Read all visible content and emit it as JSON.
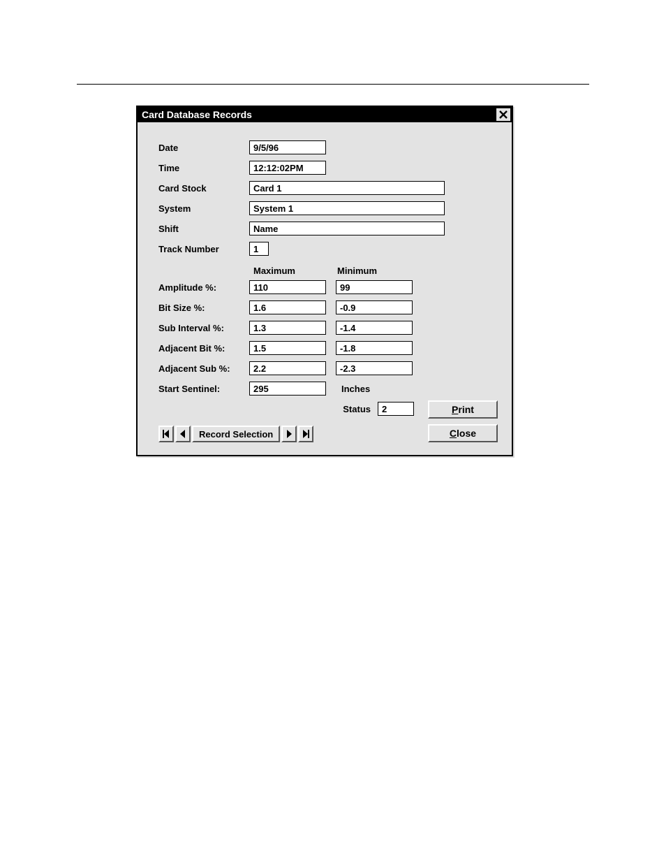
{
  "window": {
    "title": "Card Database Records"
  },
  "fields": {
    "date": {
      "label": "Date",
      "value": "9/5/96"
    },
    "time": {
      "label": "Time",
      "value": "12:12:02PM"
    },
    "card_stock": {
      "label": "Card Stock",
      "value": "Card 1"
    },
    "system": {
      "label": "System",
      "value": "System 1"
    },
    "shift": {
      "label": "Shift",
      "value": "Name"
    },
    "track_number": {
      "label": "Track Number",
      "value": "1"
    }
  },
  "columns": {
    "max": "Maximum",
    "min": "Minimum"
  },
  "metrics": {
    "amplitude": {
      "label": "Amplitude %:",
      "max": "110",
      "min": "99"
    },
    "bit_size": {
      "label": "Bit Size %:",
      "max": "1.6",
      "min": "-0.9"
    },
    "sub_interval": {
      "label": "Sub Interval %:",
      "max": "1.3",
      "min": "-1.4"
    },
    "adjacent_bit": {
      "label": "Adjacent Bit %:",
      "max": "1.5",
      "min": "-1.8"
    },
    "adjacent_sub": {
      "label": "Adjacent Sub %:",
      "max": "2.2",
      "min": "-2.3"
    },
    "start_sentinel": {
      "label": "Start Sentinel:",
      "value": "295",
      "unit": "Inches"
    }
  },
  "status": {
    "label": "Status",
    "value": "2"
  },
  "buttons": {
    "print_prefix": "P",
    "print_rest": "rint",
    "close_prefix": "C",
    "close_rest": "lose"
  },
  "nav": {
    "label": "Record Selection"
  }
}
